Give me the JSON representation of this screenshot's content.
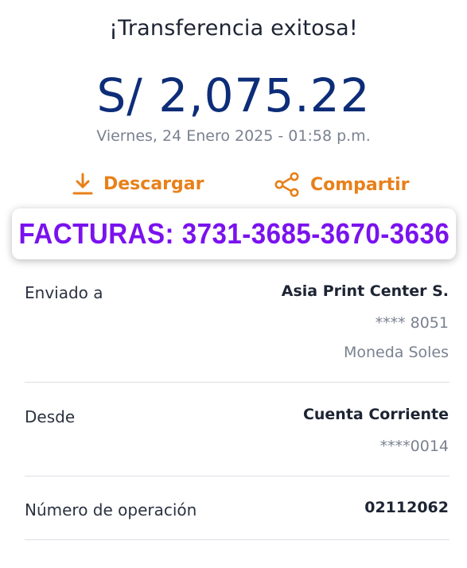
{
  "header": {
    "title": "¡Transferencia exitosa!",
    "amount": "S/ 2,075.22",
    "datetime": "Viernes, 24 Enero 2025 - 01:58 p.m."
  },
  "actions": {
    "download_label": "Descargar",
    "share_label": "Compartir",
    "accent_color": "#e8801a"
  },
  "facturas": {
    "text": "FACTURAS: 3731-3685-3670-3636",
    "color": "#7a12ee"
  },
  "details": {
    "sent_to": {
      "label": "Enviado a",
      "name": "Asia Print Center S.",
      "account": "**** 8051",
      "currency": "Moneda Soles"
    },
    "from": {
      "label": "Desde",
      "account_type": "Cuenta Corriente",
      "account": "****0014"
    },
    "operation": {
      "label": "Número de operación",
      "number": "02112062"
    }
  }
}
